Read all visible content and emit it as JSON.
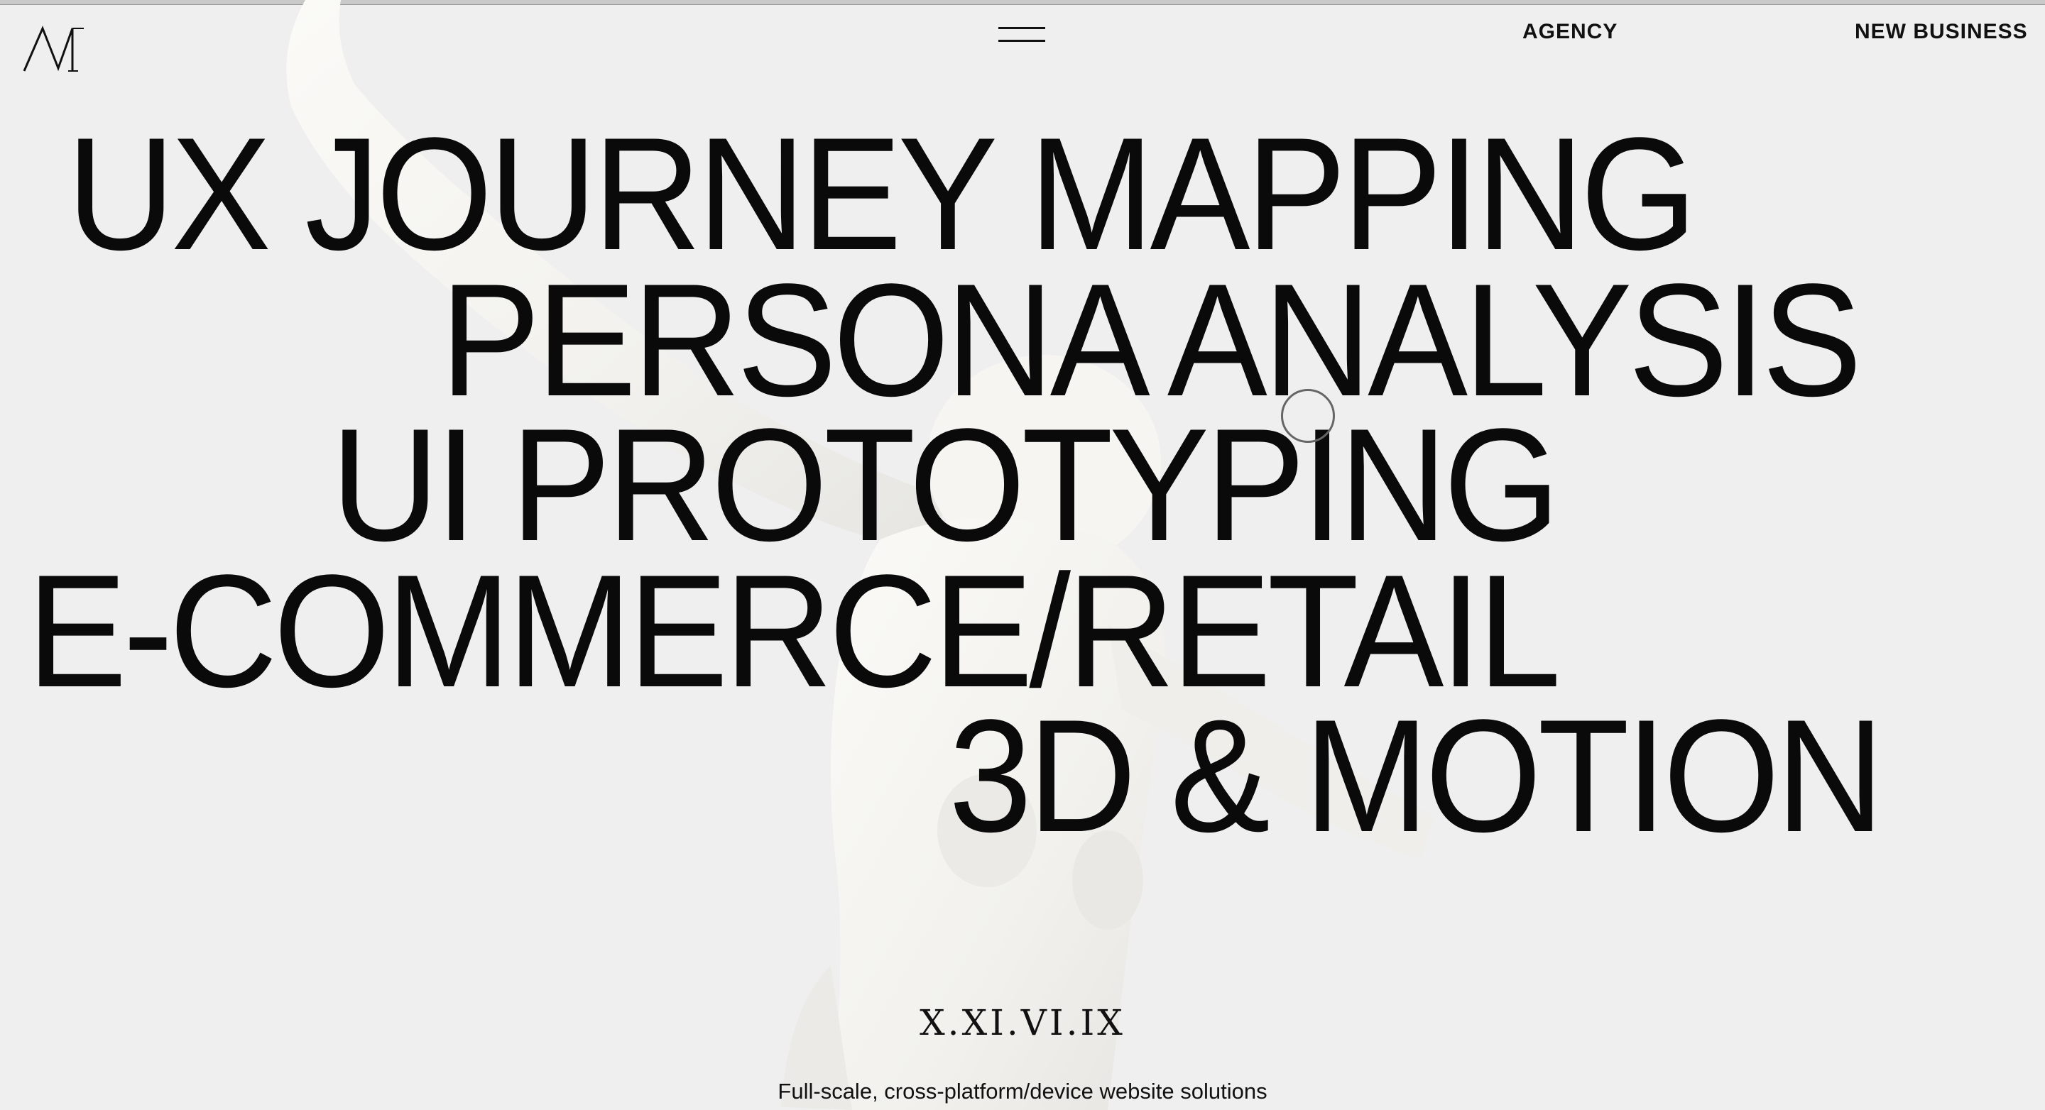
{
  "header": {
    "logo_text": "M",
    "nav": {
      "agency": "AGENCY",
      "new_business": "NEW BUSINESS"
    },
    "menu_icon": "hamburger-icon"
  },
  "services": [
    "UX JOURNEY MAPPING",
    "PERSONA ANALYSIS",
    "UI PROTOTYPING",
    "E-COMMERCE/RETAIL",
    "3D & MOTION"
  ],
  "footer": {
    "date": "X.XI.VI.IX",
    "tagline": "Full-scale, cross-platform/device website solutions"
  },
  "colors": {
    "background": "#efefef",
    "text": "#0a0a0a",
    "figure": "#f7f6f3"
  }
}
